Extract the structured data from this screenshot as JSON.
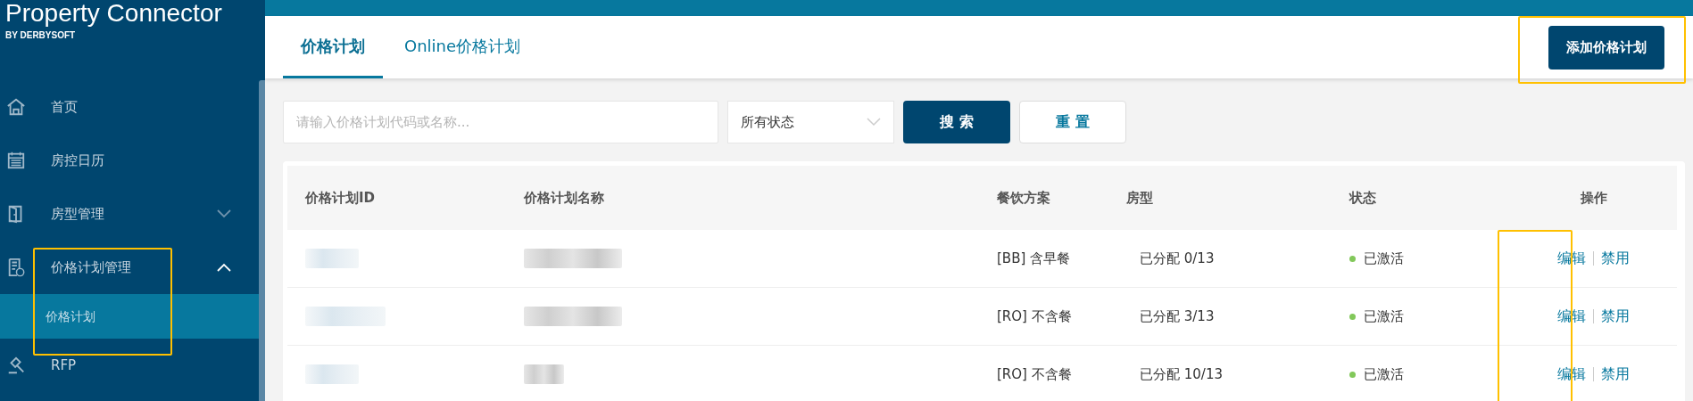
{
  "brand": {
    "name": "Property Connector",
    "byline": "BY DERBYSOFT"
  },
  "sidebar": {
    "items": [
      {
        "label": "首页"
      },
      {
        "label": "房控日历"
      },
      {
        "label": "房型管理",
        "expanded": false
      },
      {
        "label": "价格计划管理",
        "expanded": true,
        "highlighted": true,
        "children": [
          {
            "label": "价格计划",
            "selected": true
          }
        ]
      },
      {
        "label": "RFP"
      }
    ]
  },
  "tabs": [
    {
      "label": "价格计划",
      "selected": true
    },
    {
      "label": "Online价格计划",
      "selected": false
    }
  ],
  "add_button": {
    "label": "添加价格计划",
    "highlighted": true
  },
  "search": {
    "placeholder": "请输入价格计划代码或名称..."
  },
  "status_filter": {
    "value": "所有状态"
  },
  "buttons": [
    {
      "label": "搜 索",
      "kind": "primary"
    },
    {
      "label": "重 置",
      "kind": "secondary"
    }
  ],
  "table": {
    "columns": [
      "价格计划ID",
      "价格计划名称",
      "餐饮方案",
      "房型",
      "状态",
      "操作"
    ],
    "actions_highlighted": true,
    "rows": [
      {
        "id_redacted": true,
        "name_redacted": true,
        "meal": "[BB] 含早餐",
        "rooms": "已分配 0/13",
        "status": "已激活",
        "color": "#82c85a",
        "actions": [
          "编辑",
          "禁用"
        ]
      },
      {
        "id_redacted": true,
        "name_redacted": true,
        "meal": "[RO] 不含餐",
        "rooms": "已分配 3/13",
        "status": "已激活",
        "color": "#82c85a",
        "actions": [
          "编辑",
          "禁用"
        ]
      },
      {
        "id_redacted": true,
        "name_redacted": true,
        "meal": "[RO] 不含餐",
        "rooms": "已分配 10/13",
        "status": "已激活",
        "color": "#82c85a",
        "actions": [
          "编辑",
          "禁用"
        ]
      }
    ]
  }
}
